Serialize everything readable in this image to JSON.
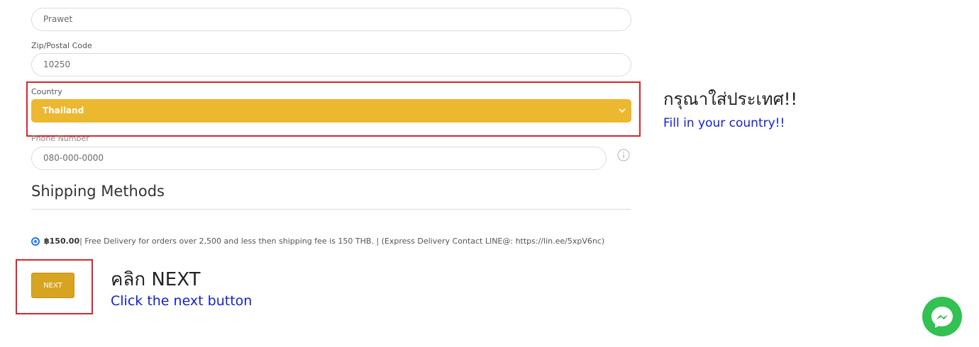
{
  "form": {
    "city_value": "Prawet",
    "zip_label": "Zip/Postal Code",
    "zip_value": "10250",
    "country_label": "Country",
    "country_selected": "Thailand",
    "phone_label": "Phone Number",
    "phone_placeholder": "080-000-0000"
  },
  "shipping": {
    "title": "Shipping Methods",
    "option_price": "฿150.00",
    "option_text": "| Free Delivery for orders over 2,500 and less then shipping fee is 150 THB. | (Express Delivery Contact LINE@: https://lin.ee/5xpV6nc)"
  },
  "buttons": {
    "next_label": "NEXT"
  },
  "annotations": {
    "country_thai": "กรุณาใส่ประเทศ!!",
    "country_eng": "Fill in your country!!",
    "next_thai": "คลิก NEXT",
    "next_eng": "Click the next button"
  },
  "colors": {
    "select_bg": "#ecb830",
    "button_bg": "#d7a421",
    "highlight_red": "#d8262e",
    "annotation_blue": "#1522c9",
    "messenger_green": "#32c152"
  },
  "icons": {
    "info": "info-icon",
    "chevron": "chevron-down-icon",
    "messenger": "messenger-icon"
  }
}
